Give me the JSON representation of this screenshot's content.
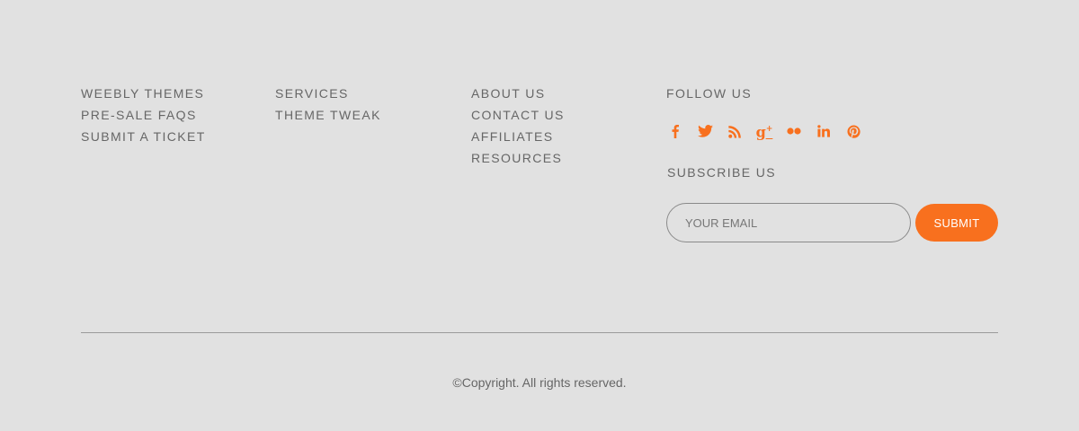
{
  "footer": {
    "columns": [
      {
        "links": [
          "WEEBLY THEMES",
          "PRE-SALE FAQS",
          "SUBMIT A TICKET"
        ]
      },
      {
        "links": [
          "SERVICES",
          "THEME TWEAK"
        ]
      },
      {
        "links": [
          "ABOUT US",
          "CONTACT US",
          "AFFILIATES",
          "RESOURCES"
        ]
      }
    ],
    "follow": {
      "heading": "FOLLOW US",
      "icons": [
        "facebook-icon",
        "twitter-icon",
        "rss-icon",
        "google-plus-icon",
        "flickr-icon",
        "linkedin-icon",
        "pinterest-icon"
      ],
      "icon_color": "#f8701e"
    },
    "subscribe": {
      "heading": "SUBSCRIBE US",
      "email_placeholder": "YOUR EMAIL",
      "email_value": "",
      "submit_label": "SUBMIT"
    },
    "copyright": "©Copyright. All rights reserved."
  },
  "colors": {
    "background": "#e1e1e1",
    "text": "#666666",
    "accent": "#f8701e",
    "divider": "#9a9a9a"
  }
}
